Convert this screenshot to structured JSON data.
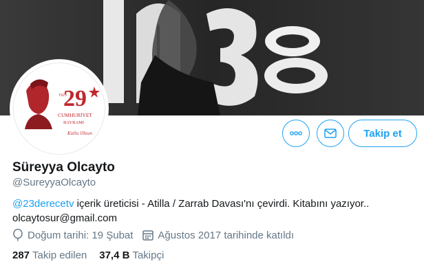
{
  "banner": {
    "text": "1938"
  },
  "avatar": {
    "number": "29",
    "year": "1923",
    "line1": "CUMHURİYET",
    "line2": "BAYRAMI",
    "tagline": "Kutlu Olsun"
  },
  "actions": {
    "follow_label": "Takip et",
    "more_icon": "more-icon",
    "message_icon": "mail-icon"
  },
  "profile": {
    "name": "Süreyya Olcayto",
    "handle": "@SureyyaOlcayto",
    "bio_mention": "@23derecetv",
    "bio_rest": " içerik üreticisi - Atilla / Zarrab Davası'nı çevirdi. Kitabını yazıyor..",
    "bio_email": "olcaytosur@gmail.com",
    "birthday": "Doğum tarihi: 19 Şubat",
    "joined": "Ağustos 2017 tarihinde katıldı"
  },
  "stats": {
    "following_count": "287",
    "following_label": "Takip edilen",
    "followers_count": "37,4 B",
    "followers_label": "Takipçi"
  },
  "colors": {
    "accent": "#1da1f2",
    "secondary": "#657786",
    "banner": "#2e2e2e"
  }
}
